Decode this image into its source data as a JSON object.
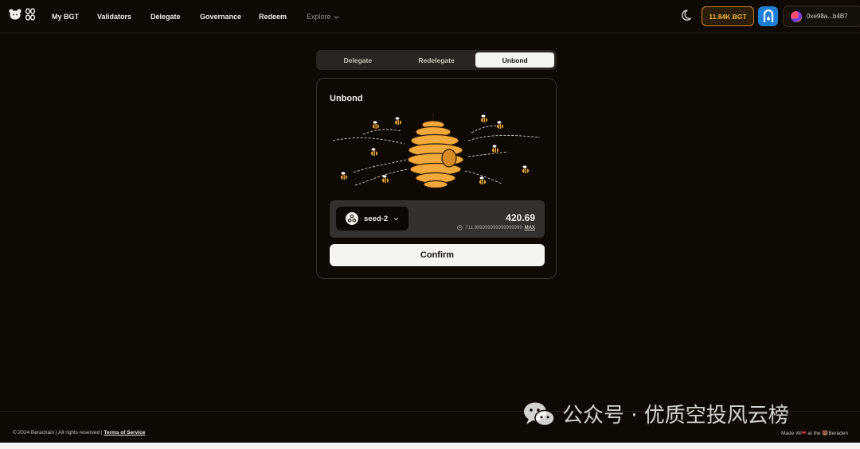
{
  "nav": {
    "links": [
      {
        "label": "My BGT"
      },
      {
        "label": "Validators"
      },
      {
        "label": "Delegate"
      },
      {
        "label": "Governance"
      },
      {
        "label": "Redeem"
      }
    ],
    "explore_label": "Explore",
    "bgt_balance": "11.84K BGT",
    "wallet_address": "0xe98a...b4B7"
  },
  "tabs": [
    {
      "label": "Delegate",
      "active": false
    },
    {
      "label": "Redelegate",
      "active": false
    },
    {
      "label": "Unbond",
      "active": true
    }
  ],
  "card": {
    "title": "Unbond",
    "validator_name": "seed-2",
    "amount": "420.69",
    "balance": "711.999999999999999999",
    "max_label": "MAX",
    "confirm_label": "Confirm"
  },
  "footer": {
    "copyright": "© 2024 Berachain | All rights reserved |",
    "terms_label": "Terms of Service",
    "made_with_prefix": "Made W/",
    "made_with_suffix": " at the ",
    "made_with_place": "Beraden"
  },
  "watermark": {
    "text": "公众号 · 优质空投风云榜"
  },
  "colors": {
    "background": "#0f0904",
    "accent_gold": "#f0b533",
    "hive": "#f2a83b",
    "button": "#f6f4ef"
  }
}
